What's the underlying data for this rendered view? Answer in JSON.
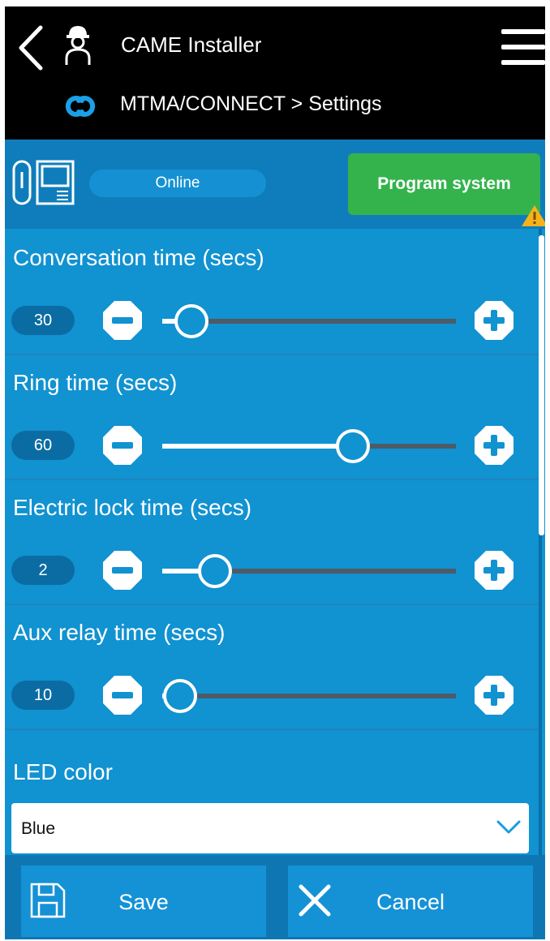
{
  "header": {
    "app_title": "CAME Installer",
    "breadcrumb": "MTMA/CONNECT > Settings",
    "icons": [
      "back-arrow-icon",
      "installer-icon",
      "menu-icon",
      "came-connect-icon"
    ]
  },
  "status": {
    "online_label": "Online",
    "program_label": "Program system",
    "icons": [
      "entry-panel-icon",
      "warning-icon"
    ]
  },
  "settings": [
    {
      "label": "Conversation time (secs)",
      "value": "30",
      "fraction": 0.1
    },
    {
      "label": "Ring time (secs)",
      "value": "60",
      "fraction": 0.65
    },
    {
      "label": "Electric lock time (secs)",
      "value": "2",
      "fraction": 0.18
    },
    {
      "label": "Aux relay time (secs)",
      "value": "10",
      "fraction": 0.06
    }
  ],
  "led": {
    "label": "LED color",
    "selected": "Blue"
  },
  "footer": {
    "save_label": "Save",
    "cancel_label": "Cancel"
  },
  "colors": {
    "background": "#1192d1",
    "status_bar": "#0f7dbb",
    "program_button": "#34b34d",
    "warning": "#f5b21b",
    "header": "#000000"
  }
}
